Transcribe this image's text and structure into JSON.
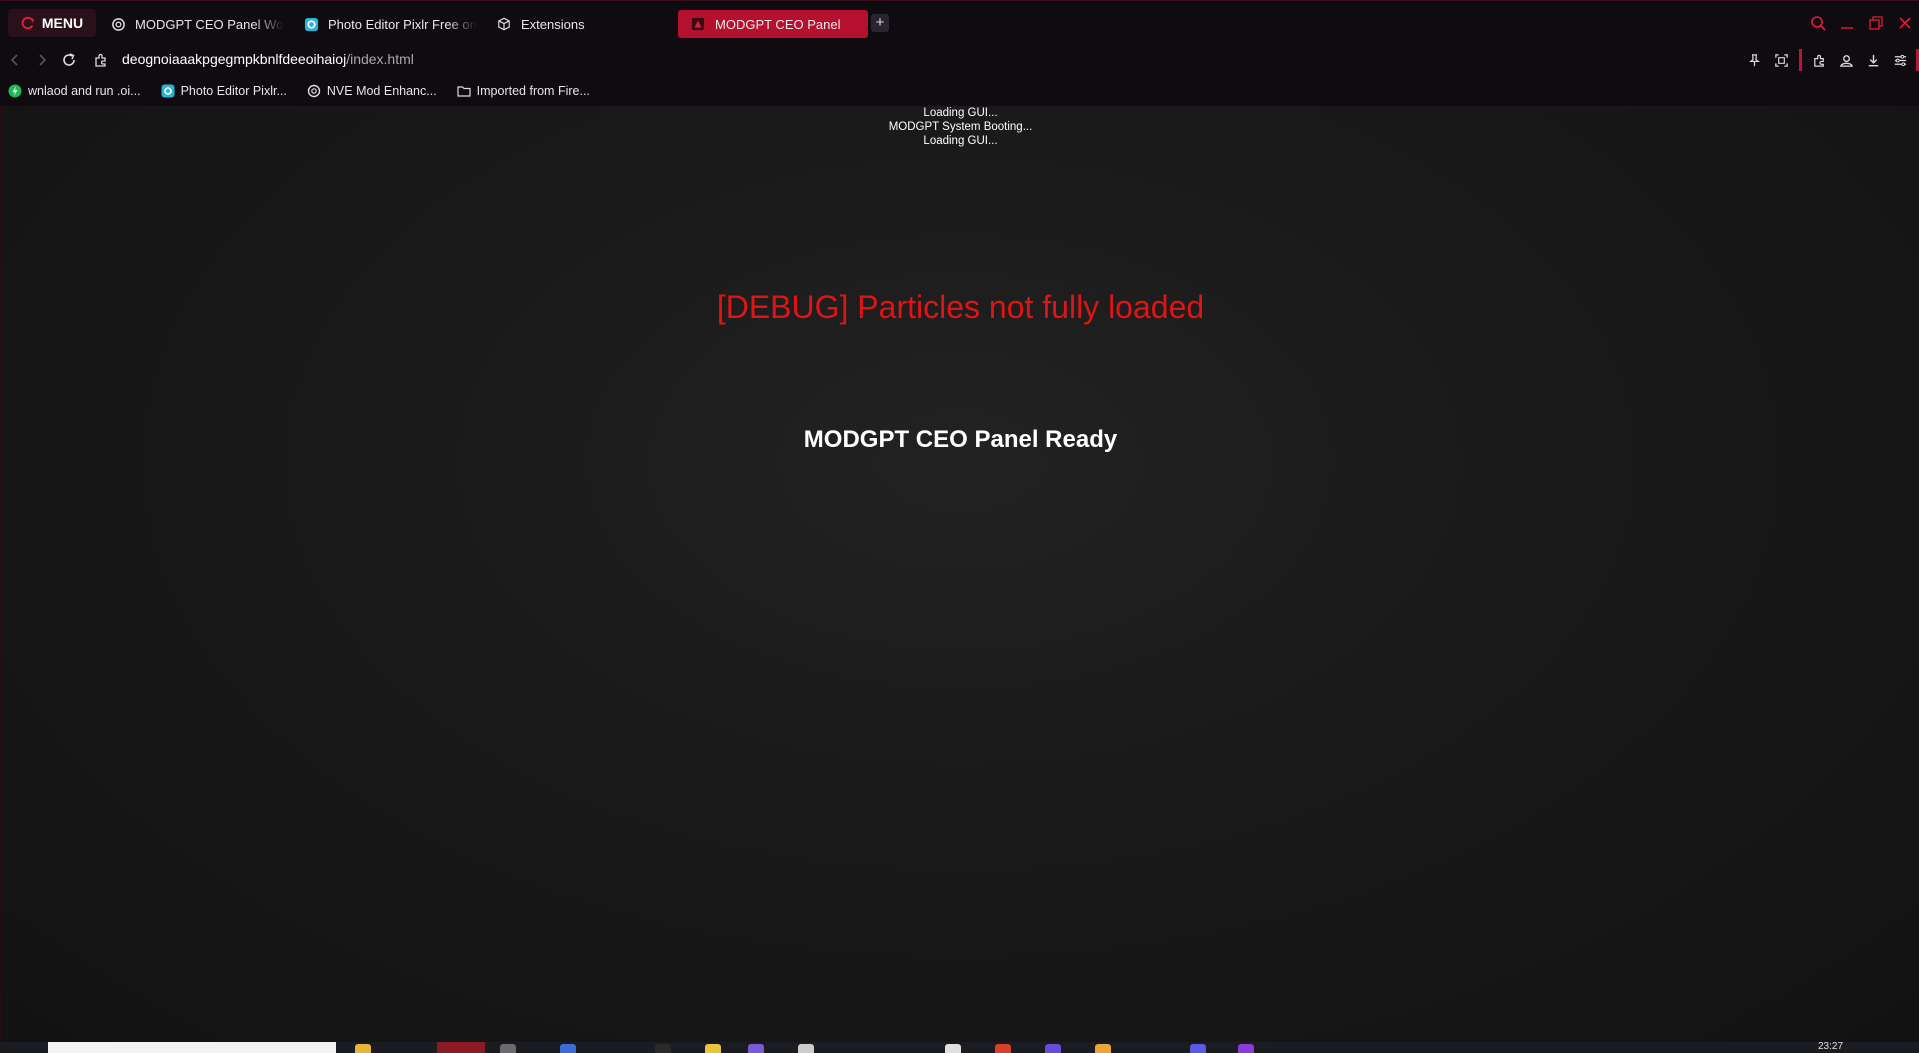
{
  "browser": {
    "menu_label": "MENU",
    "tabs": [
      {
        "label": "MODGPT CEO Panel Work",
        "icon": "openai-icon"
      },
      {
        "label": "Photo Editor Pixlr Free on",
        "icon": "pixlr-icon"
      },
      {
        "label": "Extensions",
        "icon": "cube-icon"
      },
      {
        "label": "MODGPT CEO Panel",
        "icon": "app-favicon",
        "active": true
      }
    ],
    "new_tab_label": "+",
    "url_host": "deognoiaaakpgegmpkbnlfdeeoihaioj",
    "url_path": "/index.html"
  },
  "bookmarks": [
    {
      "label": "wnlaod and run .oi...",
      "icon": "green-bolt-icon"
    },
    {
      "label": "Photo Editor Pixlr...",
      "icon": "pixlr-icon"
    },
    {
      "label": "NVE Mod Enhanc...",
      "icon": "openai-icon"
    },
    {
      "label": "Imported from Fire...",
      "icon": "folder-icon"
    }
  ],
  "page": {
    "boot_lines": [
      "Loading GUI...",
      "MODGPT System Booting...",
      "Loading GUI..."
    ],
    "debug_message": "[DEBUG] Particles not fully loaded",
    "ready_message": "MODGPT CEO Panel Ready"
  },
  "taskbar": {
    "clock": "23:27"
  },
  "colors": {
    "accent": "#b5112f",
    "debug_text": "#e01414",
    "page_bg": "#1a1a1a",
    "chrome_bg": "#0f0b11"
  }
}
